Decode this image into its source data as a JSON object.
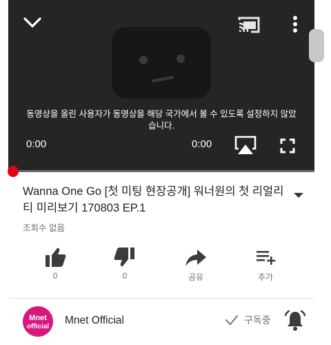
{
  "player": {
    "unavailable_message": "동영상을 올린 사용자가 동영상을 해당 국가에서 볼 수 있도록 설정하지 않았습니다.",
    "current_time": "0:00",
    "duration": "0:00",
    "progress_fraction": 0,
    "accent_color": "#e3001b",
    "icons": [
      "chevron-down-icon",
      "cast-icon",
      "more-vert-icon",
      "airplay-icon",
      "fullscreen-icon"
    ]
  },
  "video": {
    "title": "Wanna One Go [첫 미팅 현장공개] 워너원의 첫 리얼리티 미리보기 170803 EP.1",
    "views": "조회수 없음"
  },
  "actions": [
    {
      "icon": "thumbs-up-icon",
      "label": "0"
    },
    {
      "icon": "thumbs-down-icon",
      "label": "0"
    },
    {
      "icon": "share-icon",
      "label": "공유"
    },
    {
      "icon": "playlist-add-icon",
      "label": "추가"
    }
  ],
  "channel": {
    "name": "Mnet Official",
    "avatar_text": "Mnet official",
    "avatar_color": "#d8177e",
    "subscribe_label": "구독중"
  }
}
